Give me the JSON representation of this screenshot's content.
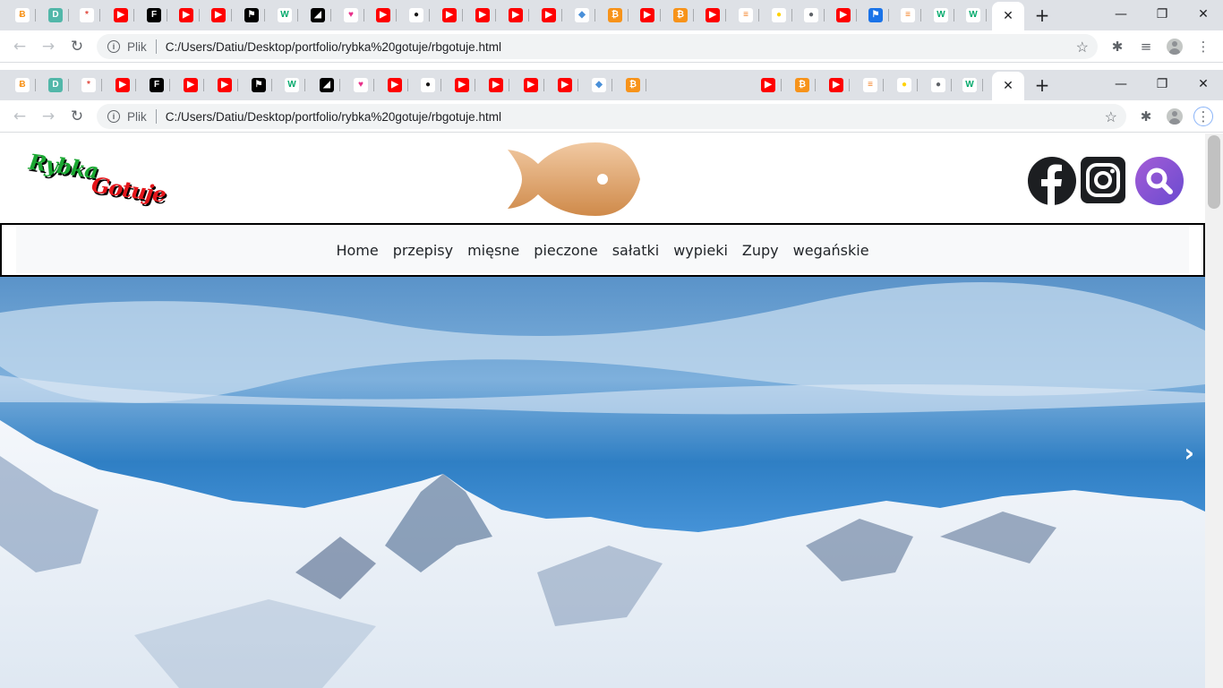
{
  "browser": {
    "address_prefix": "Plik",
    "url": "C:/Users/Datiu/Desktop/portfolio/rybka%20gotuje/rbgotuje.html",
    "tab_favicons": [
      {
        "icon": "bitcoin-b-icon",
        "glyph": "Ƀ",
        "bg": "#ffffff",
        "fg": "#f7931a"
      },
      {
        "icon": "d-square-icon",
        "glyph": "D",
        "bg": "#52b7a9",
        "fg": "#ffffff"
      },
      {
        "icon": "asterisk-icon",
        "glyph": "*",
        "bg": "#ffffff",
        "fg": "#e0453a"
      },
      {
        "icon": "youtube-icon",
        "glyph": "▶",
        "bg": "#ff0000",
        "fg": "#ffffff"
      },
      {
        "icon": "f-square-icon",
        "glyph": "F",
        "bg": "#000000",
        "fg": "#ffffff"
      },
      {
        "icon": "youtube-icon",
        "glyph": "▶",
        "bg": "#ff0000",
        "fg": "#ffffff"
      },
      {
        "icon": "youtube-icon",
        "glyph": "▶",
        "bg": "#ff0000",
        "fg": "#ffffff"
      },
      {
        "icon": "flag-icon",
        "glyph": "⚑",
        "bg": "#000000",
        "fg": "#ffffff"
      },
      {
        "icon": "w3schools-icon",
        "glyph": "W",
        "bg": "#ffffff",
        "fg": "#04aa6d"
      },
      {
        "icon": "contrast-icon",
        "glyph": "◢",
        "bg": "#000000",
        "fg": "#ffffff"
      },
      {
        "icon": "heart-check-icon",
        "glyph": "♥",
        "bg": "#ffffff",
        "fg": "#e8308a"
      },
      {
        "icon": "youtube-icon",
        "glyph": "▶",
        "bg": "#ff0000",
        "fg": "#ffffff"
      },
      {
        "icon": "github-icon",
        "glyph": "●",
        "bg": "#ffffff",
        "fg": "#181717"
      },
      {
        "icon": "youtube-icon",
        "glyph": "▶",
        "bg": "#ff0000",
        "fg": "#ffffff"
      },
      {
        "icon": "youtube-icon",
        "glyph": "▶",
        "bg": "#ff0000",
        "fg": "#ffffff"
      },
      {
        "icon": "youtube-icon",
        "glyph": "▶",
        "bg": "#ff0000",
        "fg": "#ffffff"
      },
      {
        "icon": "youtube-icon",
        "glyph": "▶",
        "bg": "#ff0000",
        "fg": "#ffffff"
      },
      {
        "icon": "cube-icon",
        "glyph": "◆",
        "bg": "#ffffff",
        "fg": "#4a90d9"
      },
      {
        "icon": "bitcoin-icon",
        "glyph": "₿",
        "bg": "#f7931a",
        "fg": "#ffffff"
      },
      {
        "icon": "youtube-icon",
        "glyph": "▶",
        "bg": "#ff0000",
        "fg": "#ffffff"
      },
      {
        "icon": "bitcoin-icon",
        "glyph": "₿",
        "bg": "#f7931a",
        "fg": "#ffffff"
      },
      {
        "icon": "youtube-icon",
        "glyph": "▶",
        "bg": "#ff0000",
        "fg": "#ffffff"
      },
      {
        "icon": "stackoverflow-icon",
        "glyph": "≡",
        "bg": "#ffffff",
        "fg": "#f48024"
      },
      {
        "icon": "sun-icon",
        "glyph": "●",
        "bg": "#ffffff",
        "fg": "#ffd200"
      },
      {
        "icon": "globe-icon",
        "glyph": "●",
        "bg": "#ffffff",
        "fg": "#5f6368"
      },
      {
        "icon": "youtube-icon",
        "glyph": "▶",
        "bg": "#ff0000",
        "fg": "#ffffff"
      },
      {
        "icon": "flag-blue-icon",
        "glyph": "⚑",
        "bg": "#1a73e8",
        "fg": "#ffffff"
      },
      {
        "icon": "stackoverflow-icon",
        "glyph": "≡",
        "bg": "#ffffff",
        "fg": "#f48024"
      },
      {
        "icon": "w3schools-icon",
        "glyph": "W",
        "bg": "#ffffff",
        "fg": "#04aa6d"
      },
      {
        "icon": "w3schools-icon",
        "glyph": "W",
        "bg": "#ffffff",
        "fg": "#04aa6d"
      }
    ],
    "window_controls": {
      "minimize": "—",
      "restore": "❐",
      "close": "✕"
    }
  },
  "site": {
    "logo_line1": "Rybka",
    "logo_line2": "Gotuje",
    "fish_color_top": "#f1c9a2",
    "fish_color_bottom": "#cf8a4a",
    "social_icons": [
      "facebook-icon",
      "instagram-icon",
      "search-icon"
    ],
    "nav": [
      "Home",
      "przepisy",
      "mięsne",
      "pieczone",
      "sałatki",
      "wypieki",
      "Zupy",
      "wegańskie"
    ],
    "carousel_next": "›"
  }
}
